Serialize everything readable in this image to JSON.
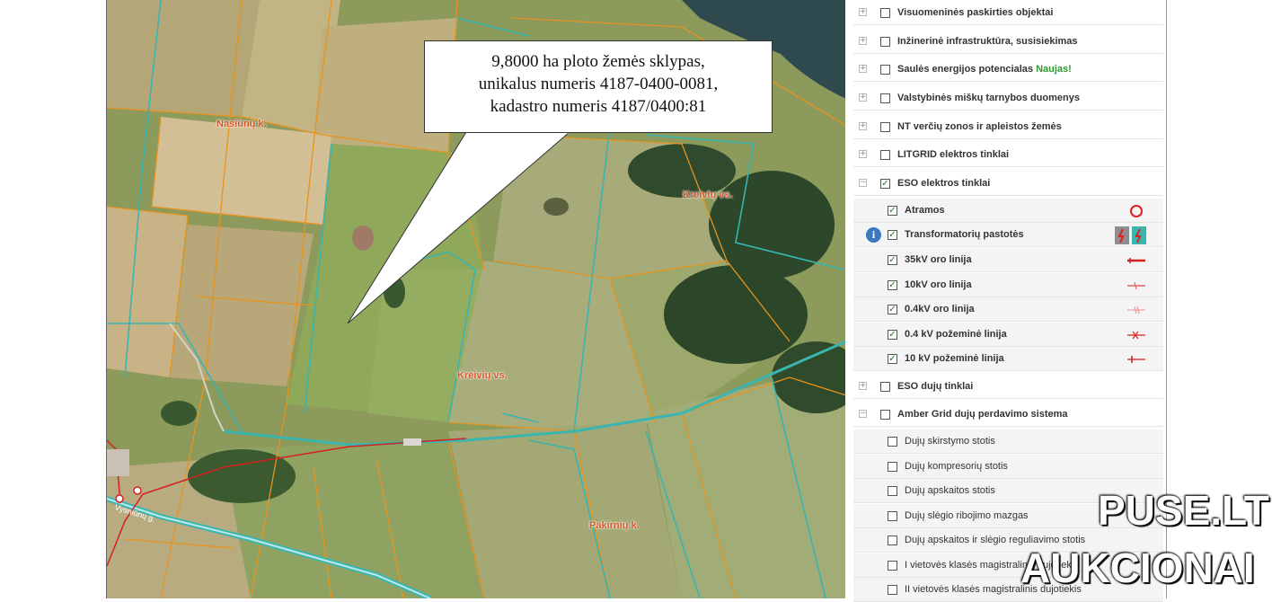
{
  "callout": {
    "line1": "9,8000 ha ploto žemės sklypas,",
    "line2": "unikalus numeris 4187-0400-0081,",
    "line3": "kadastro numeris 4187/0400:81"
  },
  "map": {
    "places": [
      "Nasiūnų k.",
      "Kreivių vs.",
      "Kreivių vs.",
      "Pakirnių k."
    ],
    "road_label": "Vysniūnų g.",
    "colors": {
      "parcel_boundary": "#e8931e",
      "road_teal": "#3ab5b0",
      "power_line": "#d42020"
    }
  },
  "panel": {
    "rows": [
      {
        "label": "Visuomeninės paskirties objektai",
        "expand": "+",
        "checked": false
      },
      {
        "label": "Inžinerinė infrastruktūra, susisiekimas",
        "expand": "+",
        "checked": false
      },
      {
        "label": "Saulės energijos potencialas",
        "badge": "Naujas!",
        "expand": "+",
        "checked": false
      },
      {
        "label": "Valstybinės miškų tarnybos duomenys",
        "expand": "+",
        "checked": false
      },
      {
        "label": "NT verčių zonos ir apleistos žemės",
        "expand": "+",
        "checked": false
      },
      {
        "label": "LITGRID elektros tinklai",
        "expand": "+",
        "checked": false
      },
      {
        "label": "ESO elektros tinklai",
        "expand": "−",
        "checked": true
      },
      {
        "label": "Atramos",
        "checked": true,
        "symbol": "circle-red-icon"
      },
      {
        "label": "Transformatorių pastotės",
        "checked": true,
        "symbol": "substation-icon",
        "info": "i"
      },
      {
        "label": "35kV oro linija",
        "checked": true,
        "symbol": "line-35kv-icon"
      },
      {
        "label": "10kV oro linija",
        "checked": true,
        "symbol": "line-10kv-icon"
      },
      {
        "label": "0.4kV oro linija",
        "checked": true,
        "symbol": "line-04kv-icon"
      },
      {
        "label": "0.4 kV požeminė linija",
        "checked": true,
        "symbol": "line-04kv-underground-icon"
      },
      {
        "label": "10 kV požeminė linija",
        "checked": true,
        "symbol": "line-10kv-underground-icon"
      },
      {
        "label": "ESO dujų tinklai",
        "expand": "+",
        "checked": false
      },
      {
        "label": "Amber Grid dujų perdavimo sistema",
        "expand": "−",
        "checked": false
      },
      {
        "label": "Dujų skirstymo stotis",
        "checked": false
      },
      {
        "label": "Dujų kompresorių stotis",
        "checked": false
      },
      {
        "label": "Dujų apskaitos stotis",
        "checked": false
      },
      {
        "label": "Dujų slėgio ribojimo mazgas",
        "checked": false
      },
      {
        "label": "Dujų apskaitos ir slėgio reguliavimo stotis",
        "checked": false
      },
      {
        "label": "I vietovės klasės magistralinis dujotiekis",
        "checked": false
      },
      {
        "label": "II vietovės klasės magistralinis dujotiekis",
        "checked": false
      }
    ]
  },
  "watermark": {
    "line1": "PUSE.LT",
    "line2": "AUKCIONAI"
  }
}
